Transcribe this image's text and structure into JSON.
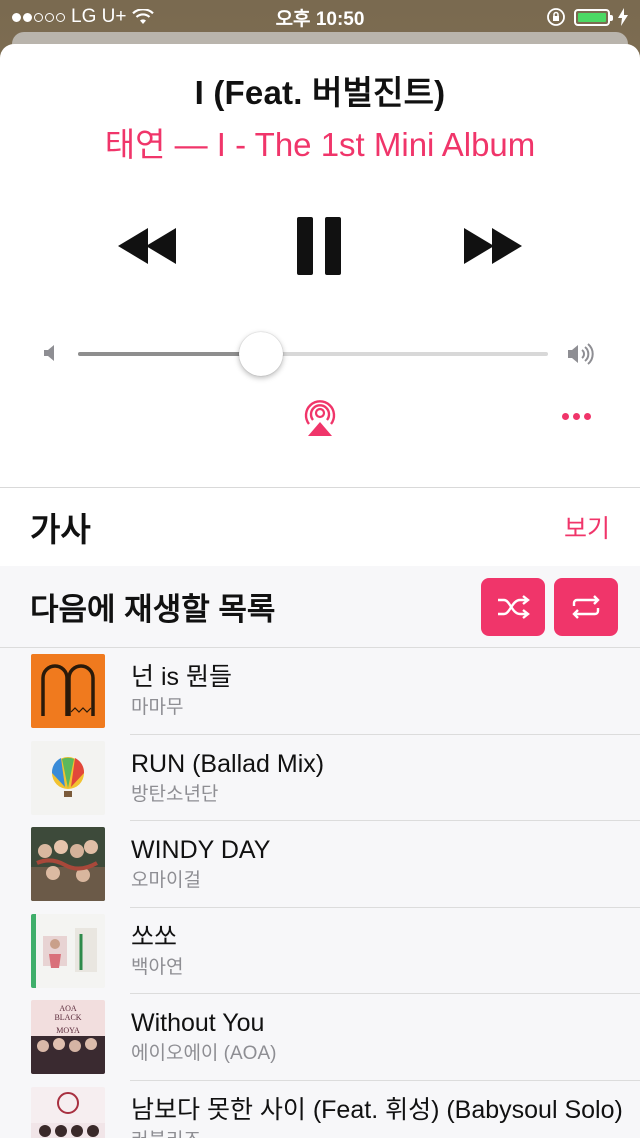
{
  "status_bar": {
    "carrier": "LG U+",
    "time": "오후 10:50",
    "signal_bars_on": 2,
    "signal_bars_total": 5,
    "battery_color": "#4cd964"
  },
  "now_playing": {
    "title": "I (Feat. 버벌진트)",
    "subtitle": "태연 — I - The 1st Mini Album",
    "accent_color": "#f0356a",
    "state": "playing",
    "volume_fraction": 0.39
  },
  "controls": {
    "prev_icon": "rewind-icon",
    "pause_icon": "pause-icon",
    "next_icon": "fast-forward-icon",
    "airplay_icon": "airplay-icon",
    "more_icon": "more-icon"
  },
  "lyrics": {
    "title": "가사",
    "show_label": "보기"
  },
  "up_next": {
    "title": "다음에 재생할 목록",
    "shuffle_icon": "shuffle-icon",
    "repeat_icon": "repeat-icon",
    "tracks": [
      {
        "title": "넌 is 뭔들",
        "artist": "마마무"
      },
      {
        "title": "RUN (Ballad Mix)",
        "artist": "방탄소년단"
      },
      {
        "title": "WINDY DAY",
        "artist": "오마이걸"
      },
      {
        "title": "쏘쏘",
        "artist": "백아연"
      },
      {
        "title": "Without You",
        "artist": "에이오에이 (AOA)"
      },
      {
        "title": "남보다 못한 사이 (Feat. 휘성) (Babysoul Solo)",
        "artist": "러블리즈"
      }
    ],
    "album_art_labels": {
      "aoa": [
        "AOA",
        "BLACK",
        "MOYA"
      ]
    }
  }
}
